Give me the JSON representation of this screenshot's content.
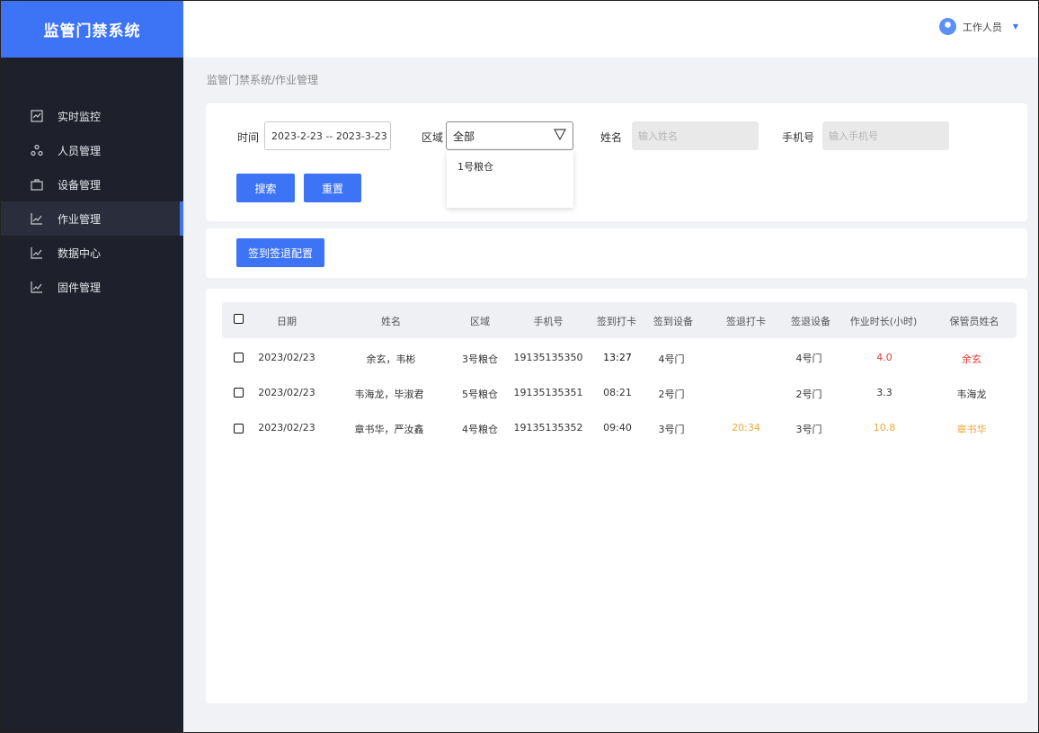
{
  "app": {
    "title": "监管门禁系统"
  },
  "sidebar": {
    "items": [
      {
        "label": "实时监控",
        "icon": "line-chart-icon"
      },
      {
        "label": "人员管理",
        "icon": "people-icon"
      },
      {
        "label": "设备管理",
        "icon": "briefcase-icon"
      },
      {
        "label": "作业管理",
        "icon": "trend-icon",
        "active": true
      },
      {
        "label": "数据中心",
        "icon": "trend-icon"
      },
      {
        "label": "固件管理",
        "icon": "trend-icon"
      }
    ]
  },
  "header": {
    "user_label": "工作人员"
  },
  "breadcrumb": "监管门禁系统/作业管理",
  "filter": {
    "time_label": "时间",
    "time_value": "2023-2-23 -- 2023-3-23",
    "region_label": "区域",
    "region_value": "全部",
    "region_options": [
      "1号粮仓"
    ],
    "name_label": "姓名",
    "name_placeholder": "输入姓名",
    "phone_label": "手机号",
    "phone_placeholder": "输入手机号",
    "search_button": "搜索",
    "reset_button": "重置"
  },
  "config_button": "签到签退配置",
  "table": {
    "columns": [
      "日期",
      "姓名",
      "区域",
      "手机号",
      "签到打卡",
      "签到设备",
      "签退打卡",
      "签退设备",
      "作业时长(小时)",
      "保管员姓名"
    ],
    "rows": [
      {
        "date": "2023/02/23",
        "name": "余玄，韦彬",
        "region": "3号粮仓",
        "phone": "19135135350",
        "checkin": "13:27",
        "checkin_device": "4号门",
        "checkout": "",
        "checkout_device": "4号门",
        "hours": "4.0",
        "keeper": "余玄",
        "status": "red"
      },
      {
        "date": "2023/02/23",
        "name": "韦海龙，毕淑君",
        "region": "5号粮仓",
        "phone": "19135135351",
        "checkin": "08:21",
        "checkin_device": "2号门",
        "checkout": "",
        "checkout_device": "2号门",
        "hours": "3.3",
        "keeper": "韦海龙",
        "status": "normal"
      },
      {
        "date": "2023/02/23",
        "name": "章书华，严汝鑫",
        "region": "4号粮仓",
        "phone": "19135135352",
        "checkin": "09:40",
        "checkin_device": "3号门",
        "checkout": "20:34",
        "checkout_device": "3号门",
        "hours": "10.8",
        "keeper": "章书华",
        "status": "orange"
      }
    ]
  },
  "colors": {
    "brand": "#3d73f5",
    "sidebar_bg": "#1e202b",
    "alert_red": "#e53935",
    "alert_orange": "#f0a73b"
  }
}
